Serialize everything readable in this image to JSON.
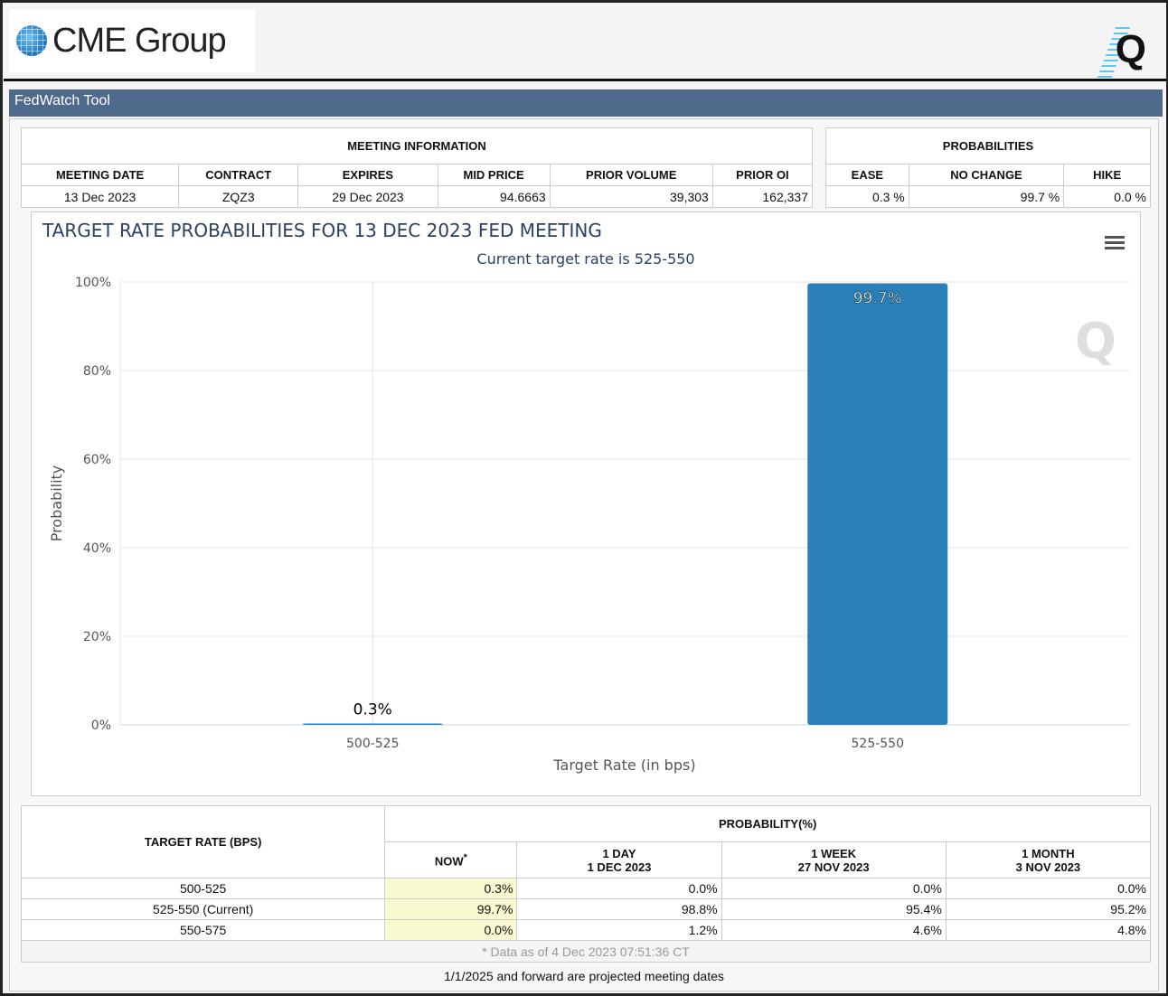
{
  "header": {
    "logo_text": "CME Group",
    "q_logo": "Q"
  },
  "tool_title": "FedWatch Tool",
  "meeting_info": {
    "title": "MEETING INFORMATION",
    "columns": [
      "MEETING DATE",
      "CONTRACT",
      "EXPIRES",
      "MID PRICE",
      "PRIOR VOLUME",
      "PRIOR OI"
    ],
    "values": [
      "13 Dec 2023",
      "ZQZ3",
      "29 Dec 2023",
      "94.6663",
      "39,303",
      "162,337"
    ]
  },
  "probabilities": {
    "title": "PROBABILITIES",
    "columns": [
      "EASE",
      "NO CHANGE",
      "HIKE"
    ],
    "values": [
      "0.3 %",
      "99.7 %",
      "0.0 %"
    ]
  },
  "chart_data": {
    "type": "bar",
    "title": "TARGET RATE PROBABILITIES FOR 13 DEC 2023 FED MEETING",
    "subtitle": "Current target rate is 525-550",
    "categories": [
      "500-525",
      "525-550"
    ],
    "values": [
      0.3,
      99.7
    ],
    "data_labels": [
      "0.3%",
      "99.7%"
    ],
    "xlabel": "Target Rate (in bps)",
    "ylabel": "Probability",
    "ylim": [
      0,
      100
    ],
    "yticks": [
      "0%",
      "20%",
      "40%",
      "60%",
      "80%",
      "100%"
    ],
    "grid": true,
    "color": "#2980b9"
  },
  "prob_table": {
    "target_header": "TARGET RATE (BPS)",
    "prob_header": "PROBABILITY(%)",
    "columns": [
      {
        "l1": "NOW",
        "l2": "",
        "sup": "*"
      },
      {
        "l1": "1 DAY",
        "l2": "1 DEC 2023"
      },
      {
        "l1": "1 WEEK",
        "l2": "27 NOV 2023"
      },
      {
        "l1": "1 MONTH",
        "l2": "3 NOV 2023"
      }
    ],
    "rows": [
      {
        "rate": "500-525",
        "vals": [
          "0.3%",
          "0.0%",
          "0.0%",
          "0.0%"
        ]
      },
      {
        "rate": "525-550 (Current)",
        "vals": [
          "99.7%",
          "98.8%",
          "95.4%",
          "95.2%"
        ]
      },
      {
        "rate": "550-575",
        "vals": [
          "0.0%",
          "1.2%",
          "4.6%",
          "4.8%"
        ]
      }
    ],
    "footnote": "* Data as of 4 Dec 2023 07:51:36 CT"
  },
  "projected_note": "1/1/2025 and forward are projected meeting dates"
}
